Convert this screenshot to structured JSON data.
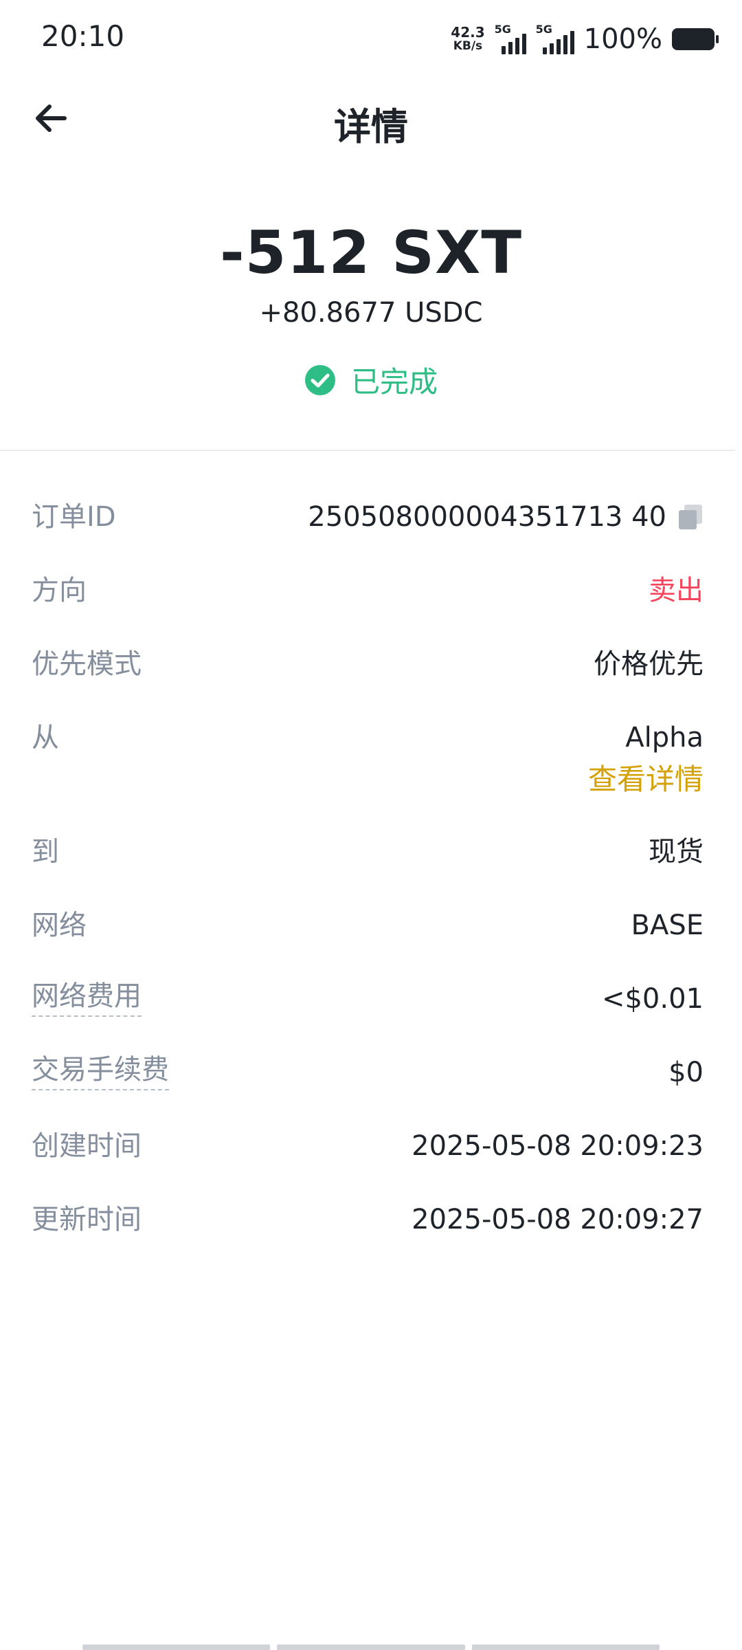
{
  "status_bar": {
    "time": "20:10",
    "net_speed_value": "42.3",
    "net_speed_unit": "KB/s",
    "sim1_label": "5G",
    "sim2_label": "5G",
    "battery_text": "100%"
  },
  "nav": {
    "title": "详情",
    "back_icon": "arrow-left-icon"
  },
  "summary": {
    "amount": "-512 SXT",
    "received": "+80.8677 USDC",
    "status": "已完成",
    "status_color": "#2ebd85"
  },
  "details": {
    "order_id_label": "订单ID",
    "order_id_value": "250508000004351713 40",
    "direction_label": "方向",
    "direction_value": "卖出",
    "priority_label": "优先模式",
    "priority_value": "价格优先",
    "from_label": "从",
    "from_value": "Alpha",
    "from_link": "查看详情",
    "to_label": "到",
    "to_value": "现货",
    "network_label": "网络",
    "network_value": "BASE",
    "network_fee_label": "网络费用",
    "network_fee_value": "<$0.01",
    "trading_fee_label": "交易手续费",
    "trading_fee_value": "$0",
    "created_label": "创建时间",
    "created_value": "2025-05-08 20:09:23",
    "updated_label": "更新时间",
    "updated_value": "2025-05-08 20:09:27"
  },
  "colors": {
    "sell_red": "#f6465d",
    "link_gold": "#d4a106",
    "label_gray": "#848e9c"
  }
}
